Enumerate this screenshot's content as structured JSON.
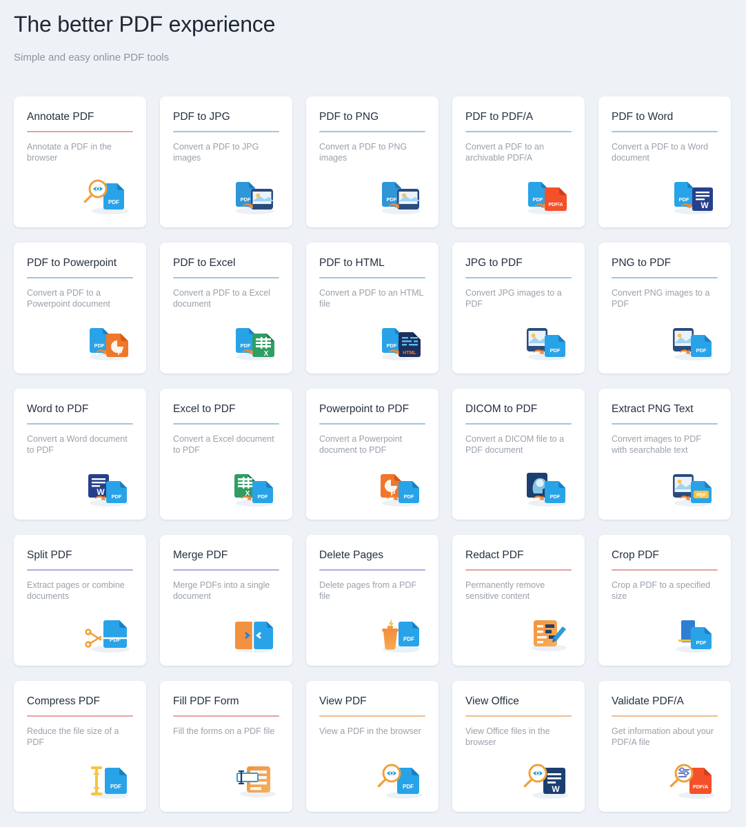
{
  "header": {
    "title": "The better PDF experience",
    "subtitle": "Simple and easy online PDF tools"
  },
  "colors": {
    "background": "#eef2f7",
    "card_background": "#ffffff",
    "title_text": "#263040",
    "description_text": "#9aa1ab",
    "rule_blue": "#9ec6de",
    "rule_red": "#e8a0a0",
    "rule_purple": "#b3a8dd",
    "rule_orange": "#edbd8a",
    "pdf_blue": "#29a3e8",
    "pdf_blue_dark": "#1b84cf",
    "word_navy": "#27408b",
    "excel_green": "#2f9e63",
    "powerpoint_orange": "#f0772a",
    "pdfa_red": "#f4502a",
    "accent_orange": "#f7a02c",
    "arrow_orange": "#f08a3c"
  },
  "cards": [
    {
      "title": "Annotate PDF",
      "description": "Annotate a PDF in the browser",
      "rule_color": "#e8a0a0",
      "icon": "annotate-pdf-icon"
    },
    {
      "title": "PDF to JPG",
      "description": "Convert a PDF to JPG images",
      "rule_color": "#9ec6de",
      "icon": "pdf-to-image-icon"
    },
    {
      "title": "PDF to PNG",
      "description": "Convert a PDF to PNG images",
      "rule_color": "#9ec6de",
      "icon": "pdf-to-image-icon"
    },
    {
      "title": "PDF to PDF/A",
      "description": "Convert a PDF to an archivable PDF/A",
      "rule_color": "#9ec6de",
      "icon": "pdf-to-pdfa-icon"
    },
    {
      "title": "PDF to Word",
      "description": "Convert a PDF to a Word document",
      "rule_color": "#9ec6de",
      "icon": "pdf-to-word-icon"
    },
    {
      "title": "PDF to Powerpoint",
      "description": "Convert a PDF to a Powerpoint document",
      "rule_color": "#9ec6de",
      "icon": "pdf-to-powerpoint-icon"
    },
    {
      "title": "PDF to Excel",
      "description": "Convert a PDF to a Excel document",
      "rule_color": "#9ec6de",
      "icon": "pdf-to-excel-icon"
    },
    {
      "title": "PDF to HTML",
      "description": "Convert a PDF to an HTML file",
      "rule_color": "#9ec6de",
      "icon": "pdf-to-html-icon"
    },
    {
      "title": "JPG to PDF",
      "description": "Convert JPG images to a PDF",
      "rule_color": "#9ec6de",
      "icon": "image-to-pdf-icon"
    },
    {
      "title": "PNG to PDF",
      "description": "Convert PNG images to a PDF",
      "rule_color": "#9ec6de",
      "icon": "image-to-pdf-icon"
    },
    {
      "title": "Word to PDF",
      "description": "Convert a Word document to PDF",
      "rule_color": "#9ec6de",
      "icon": "word-to-pdf-icon"
    },
    {
      "title": "Excel to PDF",
      "description": "Convert a Excel document to PDF",
      "rule_color": "#9ec6de",
      "icon": "excel-to-pdf-icon"
    },
    {
      "title": "Powerpoint to PDF",
      "description": "Convert a Powerpoint document to PDF",
      "rule_color": "#9ec6de",
      "icon": "powerpoint-to-pdf-icon"
    },
    {
      "title": "DICOM to PDF",
      "description": "Convert a DICOM file to a PDF document",
      "rule_color": "#9ec6de",
      "icon": "dicom-to-pdf-icon"
    },
    {
      "title": "Extract PNG Text",
      "description": "Convert images to PDF with searchable text",
      "rule_color": "#9ec6de",
      "icon": "extract-text-icon"
    },
    {
      "title": "Split PDF",
      "description": "Extract pages or combine documents",
      "rule_color": "#b3a8dd",
      "icon": "split-pdf-icon"
    },
    {
      "title": "Merge PDF",
      "description": "Merge PDFs into a single document",
      "rule_color": "#b3a8dd",
      "icon": "merge-pdf-icon"
    },
    {
      "title": "Delete Pages",
      "description": "Delete pages from a PDF file",
      "rule_color": "#b3a8dd",
      "icon": "delete-pages-icon"
    },
    {
      "title": "Redact PDF",
      "description": "Permanently remove sensitive content",
      "rule_color": "#e8a0a0",
      "icon": "redact-pdf-icon"
    },
    {
      "title": "Crop PDF",
      "description": "Crop a PDF to a specified size",
      "rule_color": "#e8a0a0",
      "icon": "crop-pdf-icon"
    },
    {
      "title": "Compress PDF",
      "description": "Reduce the file size of a PDF",
      "rule_color": "#e8a0a0",
      "icon": "compress-pdf-icon"
    },
    {
      "title": "Fill PDF Form",
      "description": "Fill the forms on a PDF file",
      "rule_color": "#e8a0a0",
      "icon": "fill-form-icon"
    },
    {
      "title": "View PDF",
      "description": "View a PDF in the browser",
      "rule_color": "#edbd8a",
      "icon": "view-pdf-icon"
    },
    {
      "title": "View Office",
      "description": "View Office files in the browser",
      "rule_color": "#edbd8a",
      "icon": "view-office-icon"
    },
    {
      "title": "Validate PDF/A",
      "description": "Get information about your PDF/A file",
      "rule_color": "#edbd8a",
      "icon": "validate-pdfa-icon"
    }
  ],
  "icon_labels": {
    "pdf": "PDF",
    "pdfa": "PDF/A",
    "html": "HTML",
    "word": "W",
    "excel": "X",
    "powerpoint": "P"
  }
}
